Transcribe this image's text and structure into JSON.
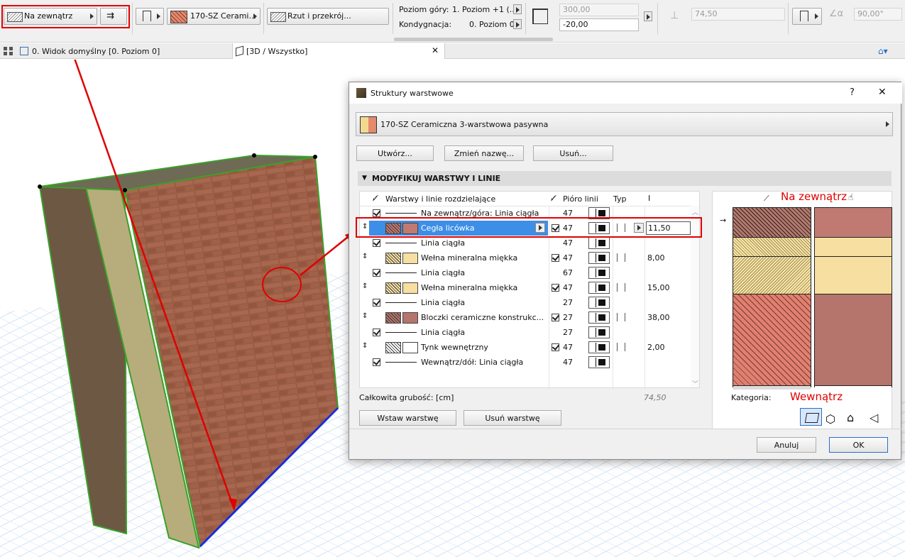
{
  "toolbar": {
    "side_label": "Na zewnątrz",
    "composite_label": "170-SZ Cerami...",
    "view_label": "Rzut i przekrój...",
    "top_story_label": "Poziom góry:",
    "top_story_value": "1. Poziom +1 (...",
    "home_story_label": "Kondygnacja:",
    "home_story_value": "0. Poziom 0",
    "height_value": "300,00",
    "offset_value": "-20,00",
    "thickness_value": "74,50",
    "angle_value": "90,00°"
  },
  "tabs": [
    {
      "label": "0. Widok domyślny [0. Poziom 0]"
    },
    {
      "label": "[3D / Wszystko]"
    }
  ],
  "dialog": {
    "title": "Struktury warstwowe",
    "help": "?",
    "close": "✕",
    "composite_name": "170-SZ Ceramiczna 3-warstwowa pasywna",
    "btn_create": "Utwórz...",
    "btn_rename": "Zmień nazwę...",
    "btn_delete": "Usuń...",
    "section_title": "MODYFIKUJ WARSTWY I LINIE",
    "col_layers": "Warstwy i linie rozdzielające",
    "col_pen": "Pióro linii",
    "col_type": "Typ",
    "rows": [
      {
        "kind": "line",
        "label": "Na zewnątrz/góra: Linia ciągła",
        "pen": "47"
      },
      {
        "kind": "layer",
        "label": "Cegła licówka",
        "pen": "47",
        "thickness": "11,50",
        "swatch": "#c07a72",
        "selected": true
      },
      {
        "kind": "line",
        "label": "Linia ciągła",
        "pen": "47"
      },
      {
        "kind": "layer",
        "label": "Wełna mineralna miękka",
        "pen": "47",
        "thickness": "8,00",
        "swatch": "#f6dfa0"
      },
      {
        "kind": "line",
        "label": "Linia ciągła",
        "pen": "67"
      },
      {
        "kind": "layer",
        "label": "Wełna mineralna miękka",
        "pen": "47",
        "thickness": "15,00",
        "swatch": "#f6dfa0"
      },
      {
        "kind": "line",
        "label": "Linia ciągła",
        "pen": "27"
      },
      {
        "kind": "layer",
        "label": "Bloczki ceramiczne konstrukc...",
        "pen": "27",
        "thickness": "38,00",
        "swatch": "#b5746c"
      },
      {
        "kind": "line",
        "label": "Linia ciągła",
        "pen": "27"
      },
      {
        "kind": "layer",
        "label": "Tynk wewnętrzny",
        "pen": "47",
        "thickness": "2,00",
        "swatch": "#ffffff"
      },
      {
        "kind": "line",
        "label": "Wewnątrz/dół: Linia ciągła",
        "pen": "47"
      }
    ],
    "total_label": "Całkowita grubość: [cm]",
    "total_value": "74,50",
    "btn_insert": "Wstaw warstwę",
    "btn_remove": "Usuń warstwę",
    "preview_outside": "Na zewnątrz",
    "preview_inside": "Wewnątrz",
    "category_label": "Kategoria:",
    "btn_cancel": "Anuluj",
    "btn_ok": "OK"
  },
  "colors": {
    "brick": "#c07a72",
    "wool": "#f6dfa0",
    "block": "#b5746c",
    "annotation_red": "#e00000",
    "ok_border": "#2a6fc9"
  }
}
